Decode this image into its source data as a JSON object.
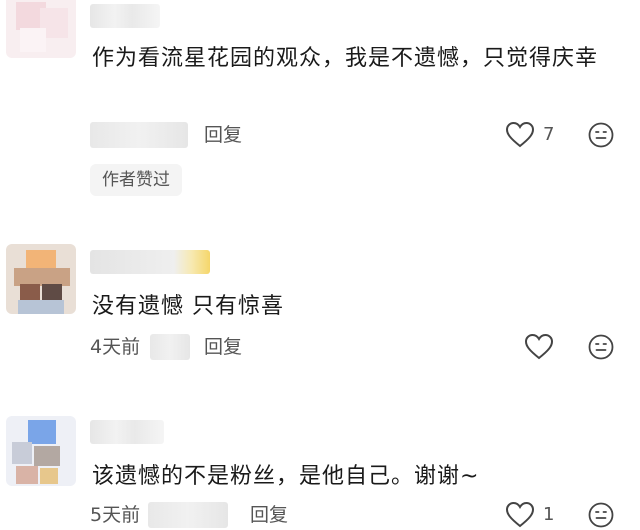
{
  "comments": [
    {
      "text": "作为看流星花园的观众，我是不遗憾，只觉得庆幸",
      "time": "",
      "reply_label": "回复",
      "likes": "7",
      "author_liked_badge": "作者赞过"
    },
    {
      "text": "没有遗憾 只有惊喜",
      "time": "4天前",
      "reply_label": "回复",
      "likes": ""
    },
    {
      "text": "该遗憾的不是粉丝，是他自己。谢谢~",
      "time": "5天前",
      "reply_label": "回复",
      "likes": "1"
    }
  ],
  "icons": {
    "like": "heart-outline-icon",
    "emoji": "smiley-face-icon"
  },
  "colors": {
    "background": "#ffffff",
    "text": "#1a1a1a",
    "meta_text": "#555555",
    "badge_bg": "#f4f4f4"
  }
}
